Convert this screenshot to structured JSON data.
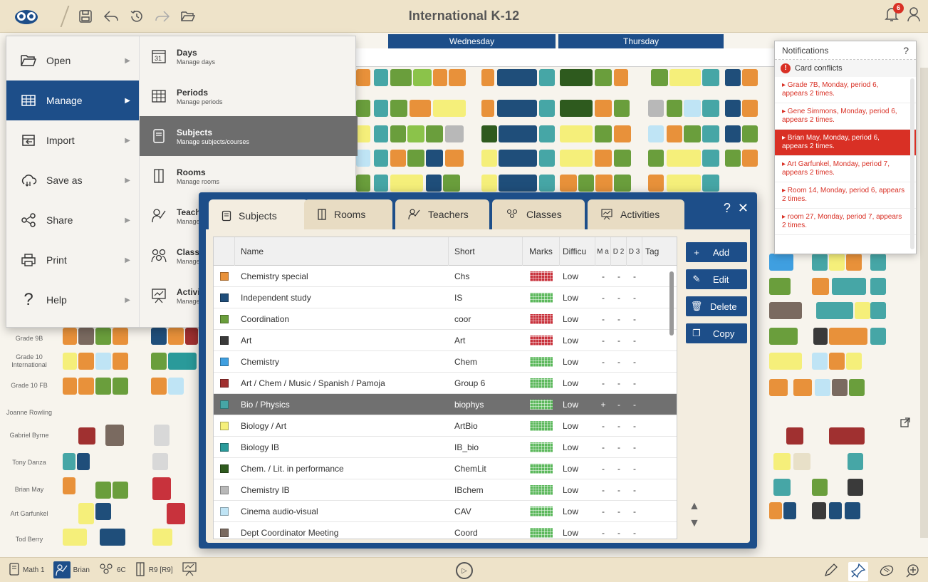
{
  "app": {
    "title": "International K-12",
    "notification_count": "6"
  },
  "timetable": {
    "days": [
      "Wednesday",
      "Thursday"
    ],
    "row_labels": [
      "Grade 9B",
      "Grade 10 International",
      "Grade 10 FB",
      "Joanne Rowling",
      "Gabriel Byrne",
      "Tony Danza",
      "Brian May",
      "Art Garfunkel",
      "Tod Berry"
    ]
  },
  "menu": {
    "items": [
      {
        "label": "Open",
        "icon": "folder-open-icon"
      },
      {
        "label": "Manage",
        "icon": "table-icon",
        "active": true
      },
      {
        "label": "Import",
        "icon": "import-icon"
      },
      {
        "label": "Save as",
        "icon": "save-as-icon"
      },
      {
        "label": "Share",
        "icon": "share-icon"
      },
      {
        "label": "Print",
        "icon": "print-icon"
      },
      {
        "label": "Help",
        "icon": "help-icon"
      }
    ],
    "submenu": [
      {
        "title": "Days",
        "desc": "Manage days",
        "icon": "calendar-icon"
      },
      {
        "title": "Periods",
        "desc": "Manage periods",
        "icon": "grid-icon"
      },
      {
        "title": "Subjects",
        "desc": "Manage subjects/courses",
        "icon": "book-icon",
        "active": true
      },
      {
        "title": "Rooms",
        "desc": "Manage rooms",
        "icon": "door-icon"
      },
      {
        "title": "Teache",
        "desc": "Manage",
        "icon": "teacher-icon"
      },
      {
        "title": "Classe",
        "desc": "Manage",
        "icon": "classes-icon"
      },
      {
        "title": "Activiti",
        "desc": "Manage",
        "icon": "activities-icon"
      }
    ]
  },
  "notifications": {
    "title": "Notifications",
    "help": "?",
    "subheader": "Card conflicts",
    "items": [
      "▸ Grade 7B, Monday, period 6, appears 2 times.",
      "▸ Gene Simmons, Monday, period 6, appears 2 times.",
      "▸ Brian May, Monday, period 6, appears 2 times.",
      "▸ Art Garfunkel, Monday, period 7, appears 2 times.",
      "▸ Room 14, Monday, period 6, appears 2 times.",
      "▸ room 27, Monday, period 7, appears 2 times."
    ]
  },
  "dialog": {
    "tabs": [
      "Subjects",
      "Rooms",
      "Teachers",
      "Classes",
      "Activities"
    ],
    "help": "?",
    "close": "✕",
    "columns": [
      "Name",
      "Short",
      "Marks",
      "Difficu",
      "M a",
      "D 2",
      "D 3",
      "Tag"
    ],
    "rows": [
      {
        "color": "#e8913a",
        "name": "Chemistry special",
        "short": "Chs",
        "marks_color": "#c8323c",
        "difficulty": "Low",
        "m": "-",
        "d2": "-",
        "d3": "-"
      },
      {
        "color": "#1f4e7a",
        "name": "Independent study",
        "short": "IS",
        "marks_color": "#5cb85c",
        "difficulty": "Low",
        "m": "-",
        "d2": "-",
        "d3": "-"
      },
      {
        "color": "#6a9e3c",
        "name": "Coordination",
        "short": "coor",
        "marks_color": "#c8323c",
        "difficulty": "Low",
        "m": "-",
        "d2": "-",
        "d3": "-"
      },
      {
        "color": "#3a3a3a",
        "name": "Art",
        "short": "Art",
        "marks_color": "#c8323c",
        "difficulty": "Low",
        "m": "-",
        "d2": "-",
        "d3": "-"
      },
      {
        "color": "#3f9fe0",
        "name": "Chemistry",
        "short": "Chem",
        "marks_color": "#5cb85c",
        "difficulty": "Low",
        "m": "-",
        "d2": "-",
        "d3": "-"
      },
      {
        "color": "#a03030",
        "name": "Art / Chem / Music / Spanish / Pamoja",
        "short": "Group 6",
        "marks_color": "#5cb85c",
        "difficulty": "Low",
        "m": "-",
        "d2": "-",
        "d3": "-"
      },
      {
        "color": "#46a6a6",
        "name": "Bio / Physics",
        "short": "biophys",
        "marks_color": "#5cb85c",
        "difficulty": "Low",
        "m": "+",
        "d2": "-",
        "d3": "-",
        "selected": true
      },
      {
        "color": "#f5ef7a",
        "name": "Biology / Art",
        "short": "ArtBio",
        "marks_color": "#5cb85c",
        "difficulty": "Low",
        "m": "-",
        "d2": "-",
        "d3": "-"
      },
      {
        "color": "#2a9a9a",
        "name": "Biology IB",
        "short": "IB_bio",
        "marks_color": "#5cb85c",
        "difficulty": "Low",
        "m": "-",
        "d2": "-",
        "d3": "-"
      },
      {
        "color": "#2e5a1e",
        "name": "Chem. / Lit. in performance",
        "short": "ChemLit",
        "marks_color": "#5cb85c",
        "difficulty": "Low",
        "m": "-",
        "d2": "-",
        "d3": "-"
      },
      {
        "color": "#b8b8b8",
        "name": "Chemistry IB",
        "short": "IBchem",
        "marks_color": "#5cb85c",
        "difficulty": "Low",
        "m": "-",
        "d2": "-",
        "d3": "-"
      },
      {
        "color": "#bfe4f5",
        "name": "Cinema audio-visual",
        "short": "CAV",
        "marks_color": "#5cb85c",
        "difficulty": "Low",
        "m": "-",
        "d2": "-",
        "d3": "-"
      },
      {
        "color": "#7a6a60",
        "name": "Dept Coordinator Meeting",
        "short": "Coord",
        "marks_color": "#5cb85c",
        "difficulty": "Low",
        "m": "-",
        "d2": "-",
        "d3": "-"
      }
    ],
    "buttons": [
      {
        "label": "Add",
        "icon": "+"
      },
      {
        "label": "Edit",
        "icon": "✎"
      },
      {
        "label": "Delete",
        "icon": "🗑"
      },
      {
        "label": "Copy",
        "icon": "❐"
      }
    ]
  },
  "bottombar": {
    "subject": "Math 1",
    "teacher": "Brian",
    "class": "6C",
    "room": "R9 [R9]"
  }
}
